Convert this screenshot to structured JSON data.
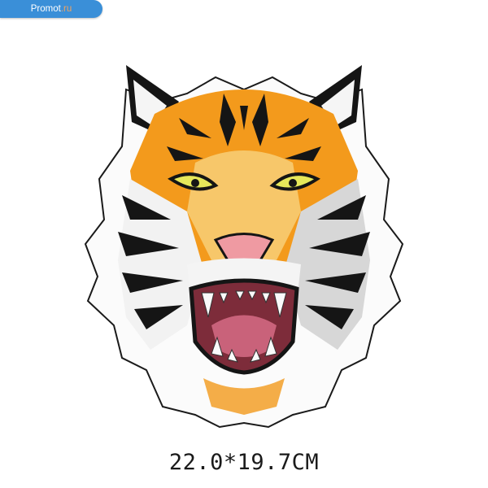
{
  "watermark": {
    "brand": "Promot",
    "tld": ".ru"
  },
  "image": {
    "subject_icon": "tiger-head-icon"
  },
  "caption": "22.0*19.7CM",
  "colors": {
    "orange": "#f39a1c",
    "light_orange": "#f7c76a",
    "black": "#151515",
    "white": "#ffffff",
    "eye_yellow": "#e6e85a",
    "nose_pink": "#ef9aa2",
    "mouth_dark": "#7d2c3a",
    "tongue": "#c9627a",
    "badge_blue": "#3a8fd8"
  }
}
